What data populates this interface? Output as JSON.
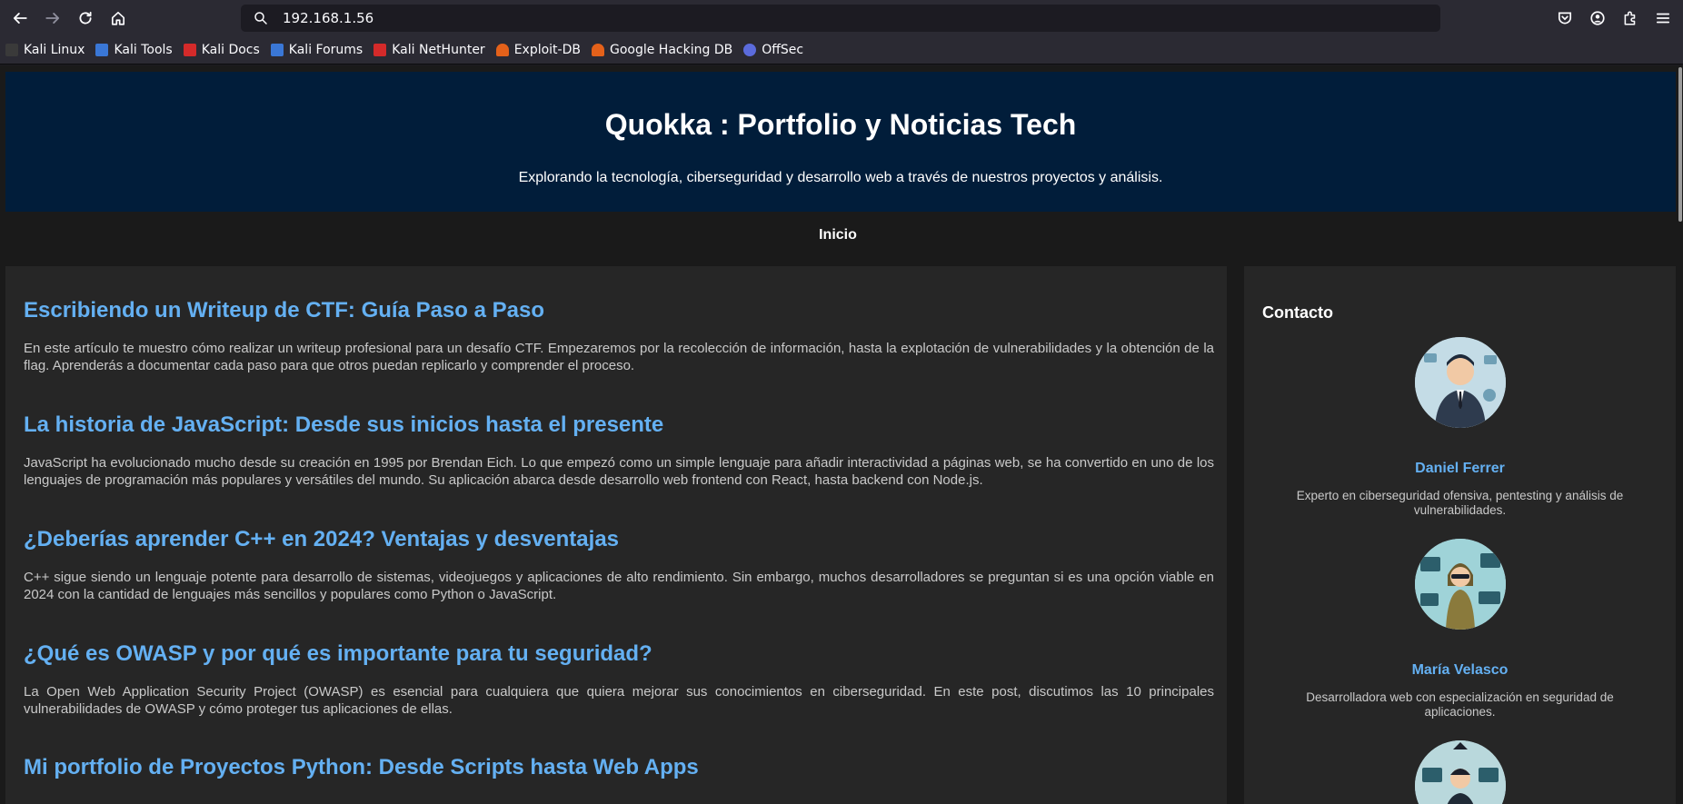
{
  "browser": {
    "url": "192.168.1.56",
    "bookmarks": [
      {
        "label": "Kali Linux",
        "icon": "kali-icon",
        "color": "#1a1a1a"
      },
      {
        "label": "Kali Tools",
        "icon": "kali-tools-icon",
        "color": "#3a77d6"
      },
      {
        "label": "Kali Docs",
        "icon": "kali-docs-icon",
        "color": "#d42a2a"
      },
      {
        "label": "Kali Forums",
        "icon": "kali-forums-icon",
        "color": "#3a77d6"
      },
      {
        "label": "Kali NetHunter",
        "icon": "nethunter-icon",
        "color": "#d42a2a"
      },
      {
        "label": "Exploit-DB",
        "icon": "exploit-db-icon",
        "color": "#e4611a"
      },
      {
        "label": "Google Hacking DB",
        "icon": "ghdb-icon",
        "color": "#e4611a"
      },
      {
        "label": "OffSec",
        "icon": "offsec-icon",
        "color": "#5b6bdc"
      }
    ]
  },
  "page": {
    "title": "Quokka : Portfolio y Noticias Tech",
    "subtitle": "Explorando la tecnología, ciberseguridad y desarrollo web a través de nuestros proyectos y análisis.",
    "nav": {
      "home": "Inicio"
    },
    "posts": [
      {
        "title": "Escribiendo un Writeup de CTF: Guía Paso a Paso",
        "body": "En este artículo te muestro cómo realizar un writeup profesional para un desafío CTF. Empezaremos por la recolección de información, hasta la explotación de vulnerabilidades y la obtención de la flag. Aprenderás a documentar cada paso para que otros puedan replicarlo y comprender el proceso."
      },
      {
        "title": "La historia de JavaScript: Desde sus inicios hasta el presente",
        "body": "JavaScript ha evolucionado mucho desde su creación en 1995 por Brendan Eich. Lo que empezó como un simple lenguaje para añadir interactividad a páginas web, se ha convertido en uno de los lenguajes de programación más populares y versátiles del mundo. Su aplicación abarca desde desarrollo web frontend con React, hasta backend con Node.js."
      },
      {
        "title": "¿Deberías aprender C++ en 2024? Ventajas y desventajas",
        "body": "C++ sigue siendo un lenguaje potente para desarrollo de sistemas, videojuegos y aplicaciones de alto rendimiento. Sin embargo, muchos desarrolladores se preguntan si es una opción viable en 2024 con la cantidad de lenguajes más sencillos y populares como Python o JavaScript."
      },
      {
        "title": "¿Qué es OWASP y por qué es importante para tu seguridad?",
        "body": "La Open Web Application Security Project (OWASP) es esencial para cualquiera que quiera mejorar sus conocimientos en ciberseguridad. En este post, discutimos las 10 principales vulnerabilidades de OWASP y cómo proteger tus aplicaciones de ellas."
      },
      {
        "title": "Mi portfolio de Proyectos Python: Desde Scripts hasta Web Apps",
        "body": ""
      }
    ],
    "contact": {
      "heading": "Contacto",
      "people": [
        {
          "name": "Daniel Ferrer",
          "bio": "Experto en ciberseguridad ofensiva, pentesting y análisis de vulnerabilidades."
        },
        {
          "name": "María Velasco",
          "bio": "Desarrolladora web con especialización en seguridad de aplicaciones."
        },
        {
          "name": "",
          "bio": ""
        }
      ]
    }
  },
  "colors": {
    "accent": "#64b0f2",
    "hero_bg": "#011d3a",
    "card_bg": "#262626"
  }
}
